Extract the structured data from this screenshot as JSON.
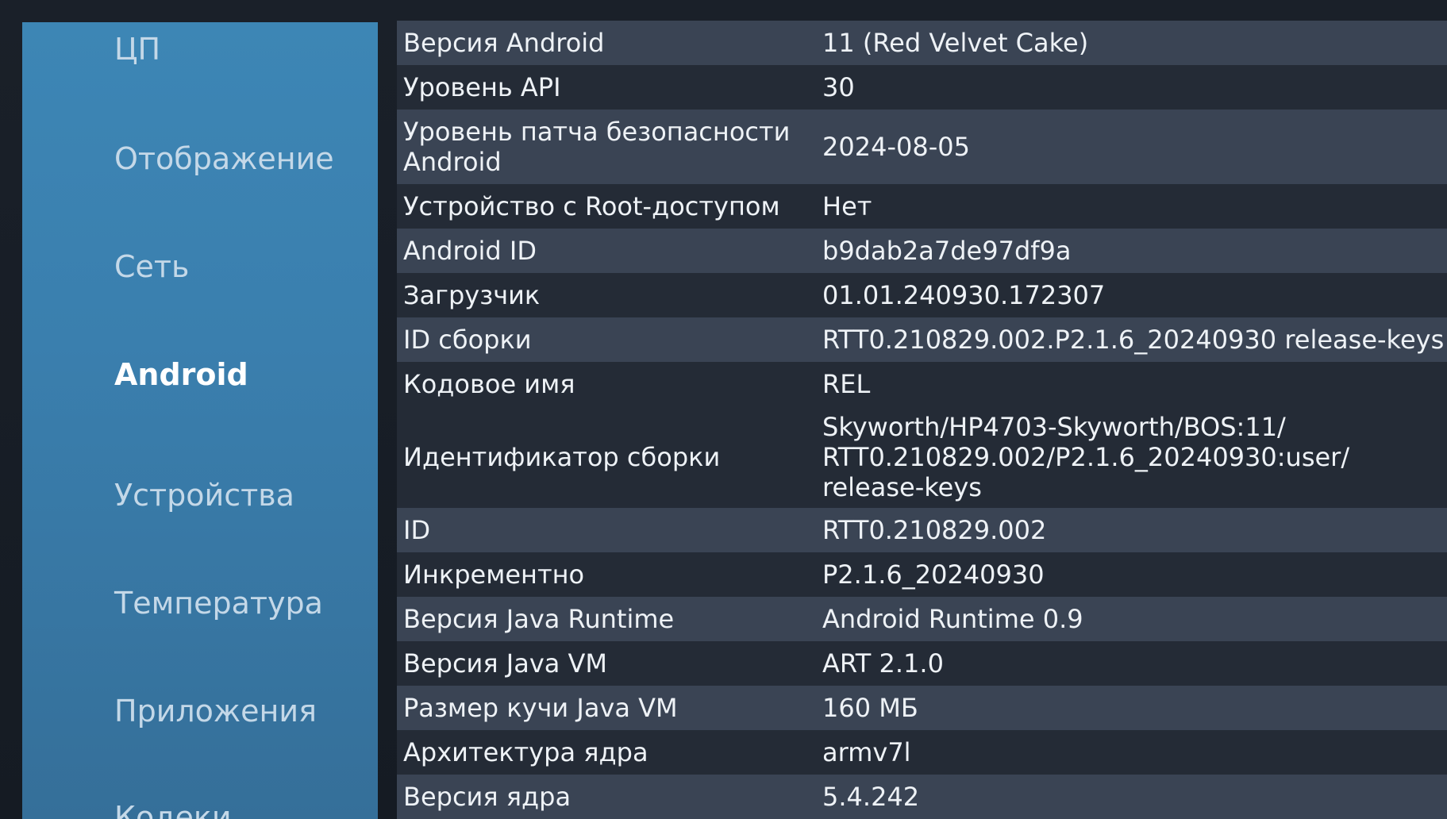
{
  "sidebar": {
    "items": [
      {
        "label": "ЦП",
        "active": false
      },
      {
        "label": "Отображение",
        "active": false
      },
      {
        "label": "Сеть",
        "active": false
      },
      {
        "label": "Android",
        "active": true
      },
      {
        "label": "Устройства",
        "active": false
      },
      {
        "label": "Температура",
        "active": false
      },
      {
        "label": "Приложения",
        "active": false
      },
      {
        "label": "Кодеки",
        "active": false
      }
    ]
  },
  "info": {
    "rows": [
      {
        "key": "Версия Android",
        "value": "11 (Red Velvet Cake)"
      },
      {
        "key": "Уровень API",
        "value": "30"
      },
      {
        "key": "Уровень патча безопасности Android",
        "value": "2024-08-05"
      },
      {
        "key": "Устройство с Root-доступом",
        "value": "Нет"
      },
      {
        "key": "Android ID",
        "value": "b9dab2a7de97df9a"
      },
      {
        "key": "Загрузчик",
        "value": "01.01.240930.172307"
      },
      {
        "key": "ID сборки",
        "value": "RTT0.210829.002.P2.1.6_20240930 release-keys"
      },
      {
        "key": "Кодовое имя",
        "value": "REL"
      },
      {
        "key": "Идентификатор сборки",
        "value": "Skyworth/HP4703-Skyworth/BOS:11/ RTT0.210829.002/P2.1.6_20240930:user/ release-keys"
      },
      {
        "key": "ID",
        "value": "RTT0.210829.002"
      },
      {
        "key": "Инкрементно",
        "value": "P2.1.6_20240930"
      },
      {
        "key": "Версия Java Runtime",
        "value": "Android Runtime 0.9"
      },
      {
        "key": "Версия Java VM",
        "value": "ART 2.1.0"
      },
      {
        "key": "Размер кучи Java VM",
        "value": "160 МБ"
      },
      {
        "key": "Архитектура ядра",
        "value": "armv7l"
      },
      {
        "key": "Версия ядра",
        "value": "5.4.242"
      }
    ]
  },
  "colors": {
    "sidebar_bg": "#3d86b5",
    "row_light": "#3a4454",
    "row_dark": "#242b36",
    "screen_bg": "#161c24"
  }
}
